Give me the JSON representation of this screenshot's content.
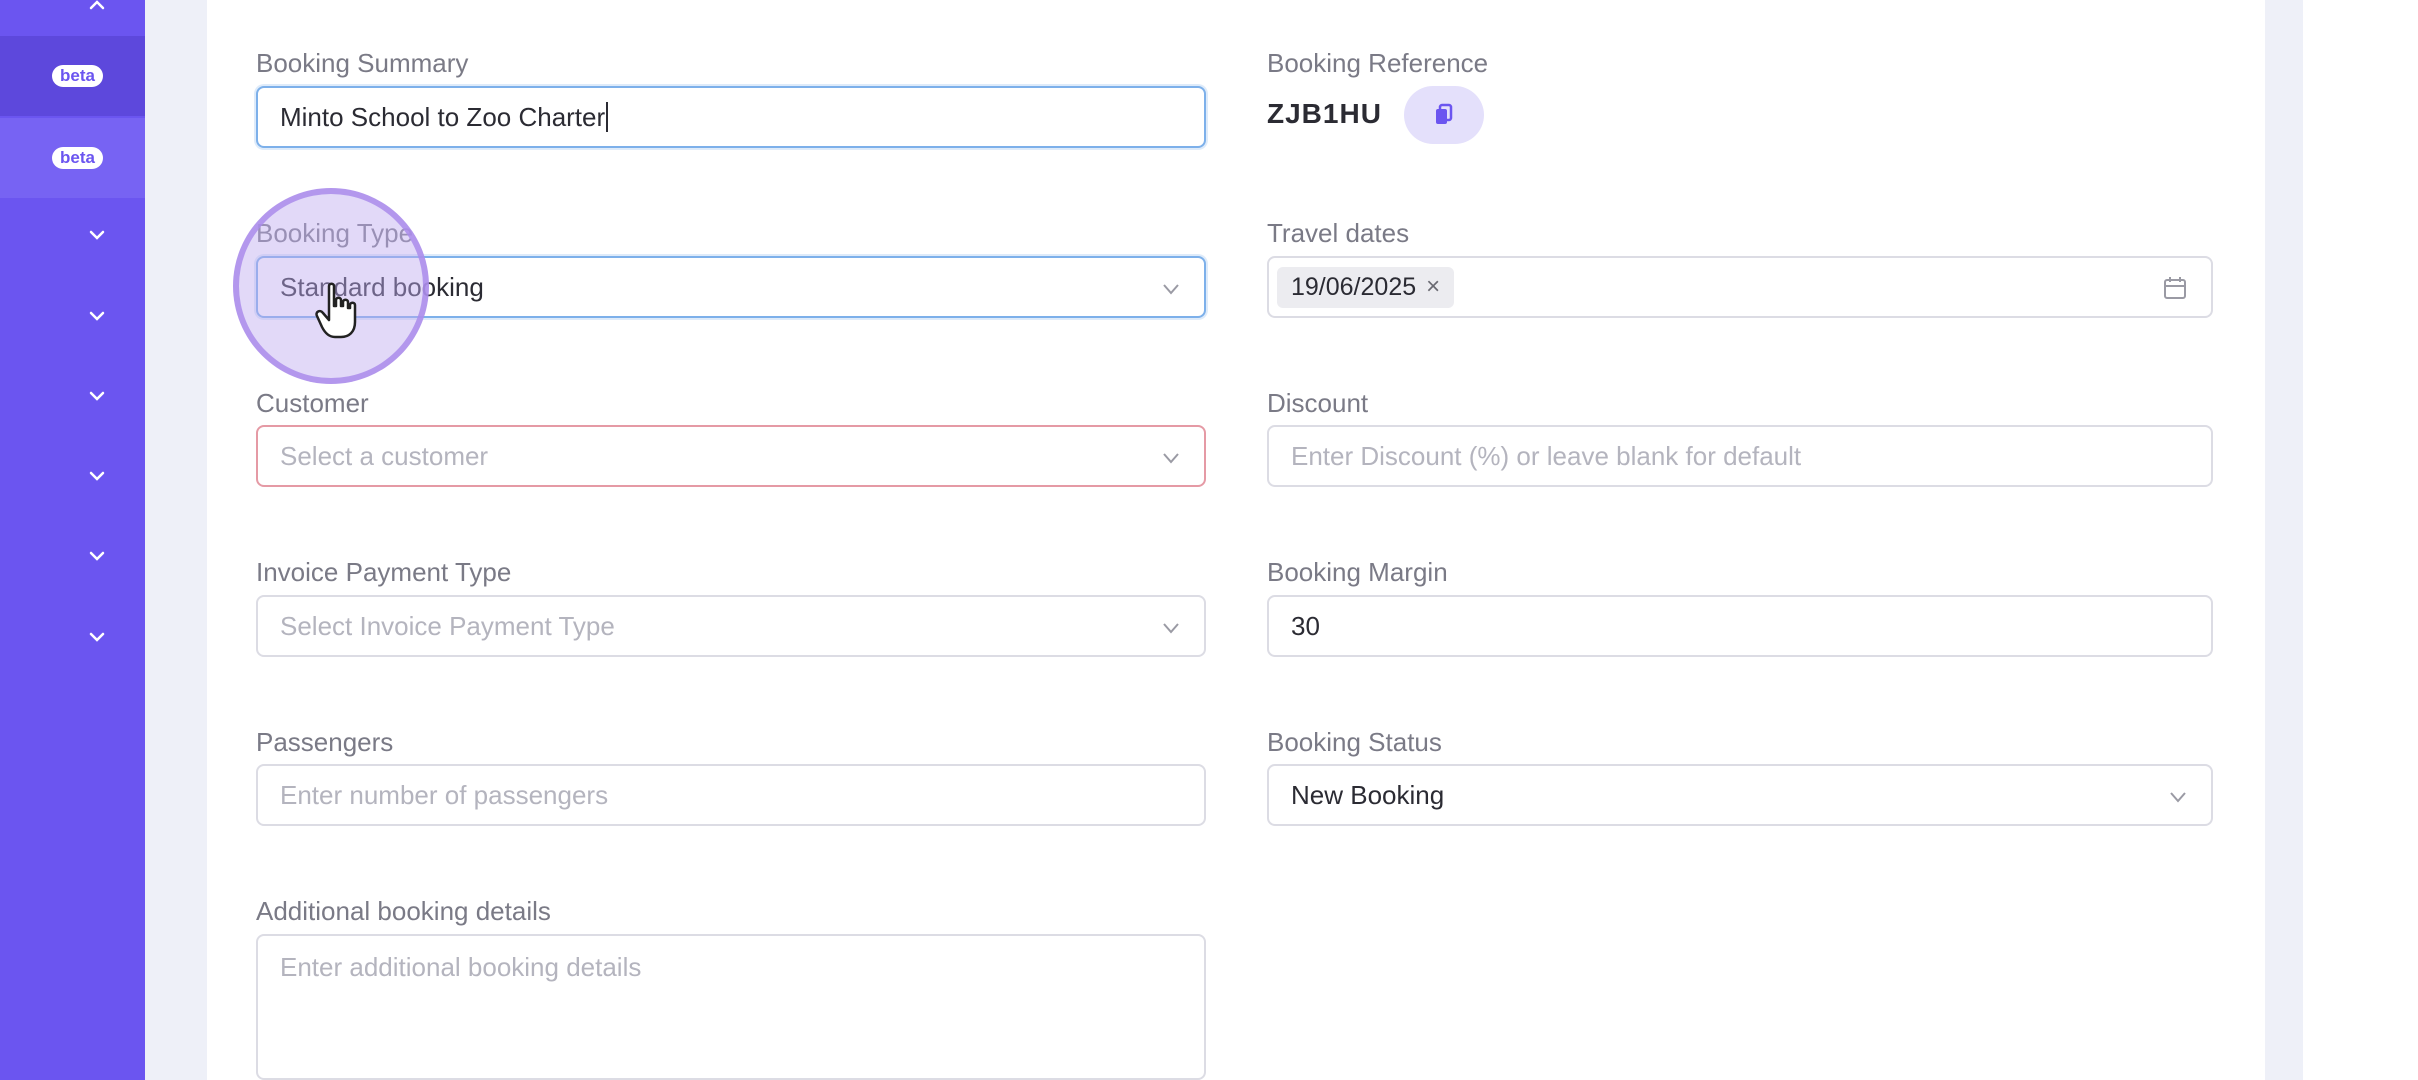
{
  "sidebar": {
    "beta_badges": [
      "beta",
      "beta"
    ],
    "expand_icons": [
      "chevron-down-icon",
      "chevron-down-icon",
      "chevron-down-icon",
      "chevron-down-icon",
      "chevron-down-icon",
      "chevron-down-icon"
    ]
  },
  "form": {
    "booking_summary": {
      "label": "Booking Summary",
      "value": "Minto School to Zoo Charter"
    },
    "booking_reference": {
      "label": "Booking Reference",
      "value": "ZJB1HU"
    },
    "booking_type": {
      "label": "Booking Type",
      "value": "Standard booking"
    },
    "travel_dates": {
      "label": "Travel dates",
      "chip": "19/06/2025",
      "remove": "×"
    },
    "customer": {
      "label": "Customer",
      "placeholder": "Select a customer"
    },
    "discount": {
      "label": "Discount",
      "placeholder": "Enter Discount (%) or leave blank for default"
    },
    "invoice_payment_type": {
      "label": "Invoice Payment Type",
      "placeholder": "Select Invoice Payment Type"
    },
    "booking_margin": {
      "label": "Booking Margin",
      "value": "30"
    },
    "passengers": {
      "label": "Passengers",
      "placeholder": "Enter number of passengers"
    },
    "booking_status": {
      "label": "Booking Status",
      "value": "New Booking"
    },
    "additional_details": {
      "label": "Additional booking details",
      "placeholder": "Enter additional booking details"
    }
  },
  "colors": {
    "sidebar": "#6b55f0",
    "focus_border": "#7db0ea",
    "error_border": "#e59aa5",
    "copy_button_bg": "#e4e0fb"
  }
}
